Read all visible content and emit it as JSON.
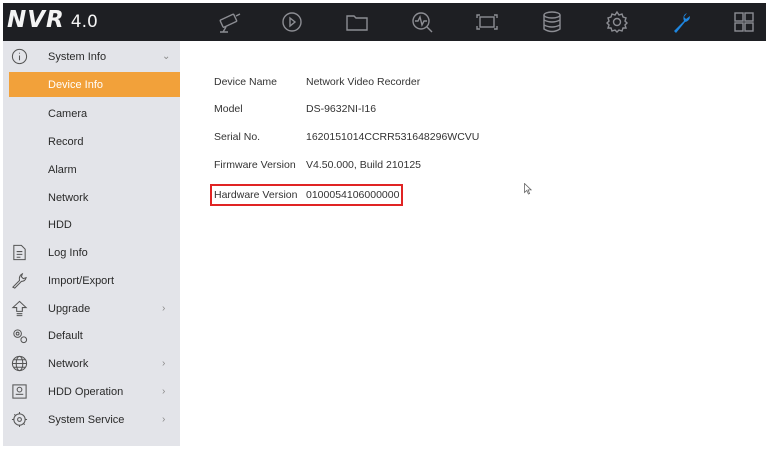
{
  "app": {
    "brand": "NVR",
    "version": "4.0"
  },
  "toolbar": {
    "icons": [
      "camera-icon",
      "playback-icon",
      "folder-icon",
      "search-icon",
      "screen-icon",
      "storage-icon",
      "settings-icon",
      "maintenance-icon",
      "grid-icon"
    ],
    "active": "maintenance-icon"
  },
  "sidebar": {
    "items": [
      {
        "label": "System Info",
        "icon": "info-icon",
        "chevron": "⌄"
      },
      {
        "label": "Device Info",
        "active": true
      },
      {
        "label": "Camera"
      },
      {
        "label": "Record"
      },
      {
        "label": "Alarm"
      },
      {
        "label": "Network"
      },
      {
        "label": "HDD"
      },
      {
        "label": "Log Info",
        "icon": "log-icon"
      },
      {
        "label": "Import/Export",
        "icon": "wrench-icon"
      },
      {
        "label": "Upgrade",
        "icon": "upgrade-icon",
        "chevron": "›"
      },
      {
        "label": "Default",
        "icon": "default-icon"
      },
      {
        "label": "Network",
        "icon": "network-icon",
        "chevron": "›"
      },
      {
        "label": "HDD Operation",
        "icon": "hdd-icon",
        "chevron": "›"
      },
      {
        "label": "System Service",
        "icon": "service-icon",
        "chevron": "›"
      }
    ]
  },
  "device_info": {
    "rows": [
      {
        "label": "Device Name",
        "value": "Network Video Recorder"
      },
      {
        "label": "Model",
        "value": "DS-9632NI-I16"
      },
      {
        "label": "Serial No.",
        "value": "1620151014CCRR531648296WCVU"
      },
      {
        "label": "Firmware Version",
        "value": "V4.50.000, Build 210125"
      },
      {
        "label": "Hardware Version",
        "value": "0100054106000000"
      }
    ],
    "highlighted_row": "Hardware Version"
  },
  "colors": {
    "topbar": "#1e1f23",
    "accent_orange": "#f2a13a",
    "active_tool_blue": "#1e86e0",
    "sidebar_bg": "#e3e4e9",
    "highlight_red": "#e02424"
  }
}
